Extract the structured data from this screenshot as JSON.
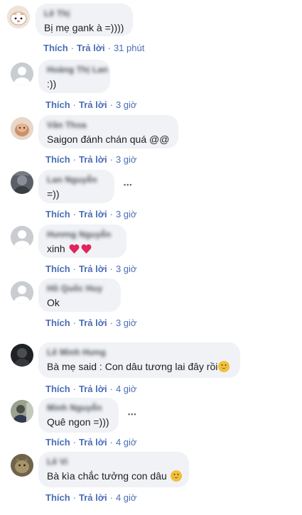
{
  "comments": [
    {
      "name": "Lê Thị",
      "text": "Bị mẹ gank à =))))",
      "like": "Thích",
      "reply": "Trả lời",
      "time": "31 phút",
      "avatar_color": "#e9d8c8"
    },
    {
      "name": "Hoàng Thị Lan",
      "text": ":))",
      "like": "Thích",
      "reply": "Trả lời",
      "time": "3 giờ",
      "avatar_color": "#c9ccd1"
    },
    {
      "name": "Văn Thoa",
      "text": "Saigon đánh chán quá @@",
      "like": "Thích",
      "reply": "Trả lời",
      "time": "3 giờ",
      "avatar_color": "#d9b8a6"
    },
    {
      "name": "Lan Nguyễn",
      "text": "=))",
      "like": "Thích",
      "reply": "Trả lời",
      "time": "3 giờ",
      "avatar_color": "#54585f"
    },
    {
      "name": "Hương Nguyễn",
      "text": "xinh",
      "like": "Thích",
      "reply": "Trả lời",
      "time": "3 giờ",
      "avatar_color": "#c9ccd1"
    },
    {
      "name": "Hồ Quốc Huy",
      "text": "Ok",
      "like": "Thích",
      "reply": "Trả lời",
      "time": "3 giờ",
      "avatar_color": "#c9ccd1"
    },
    {
      "name": "Lê Minh Hưng",
      "text": "Bà mẹ said : Con dâu tương lai đây rồi",
      "like": "Thích",
      "reply": "Trả lời",
      "time": "4 giờ",
      "avatar_color": "#2a2d33"
    },
    {
      "name": "Minh Nguyễn",
      "text": "Quê ngon =)))",
      "like": "Thích",
      "reply": "Trả lời",
      "time": "4 giờ",
      "avatar_color": "#6d7b63"
    },
    {
      "name": "Lê Vi",
      "text": "Bà kìa chắc tưởng con dâu",
      "like": "Thích",
      "reply": "Trả lời",
      "time": "4 giờ",
      "avatar_color": "#8a7a5a"
    }
  ],
  "separator": "·",
  "more_label": "•••"
}
